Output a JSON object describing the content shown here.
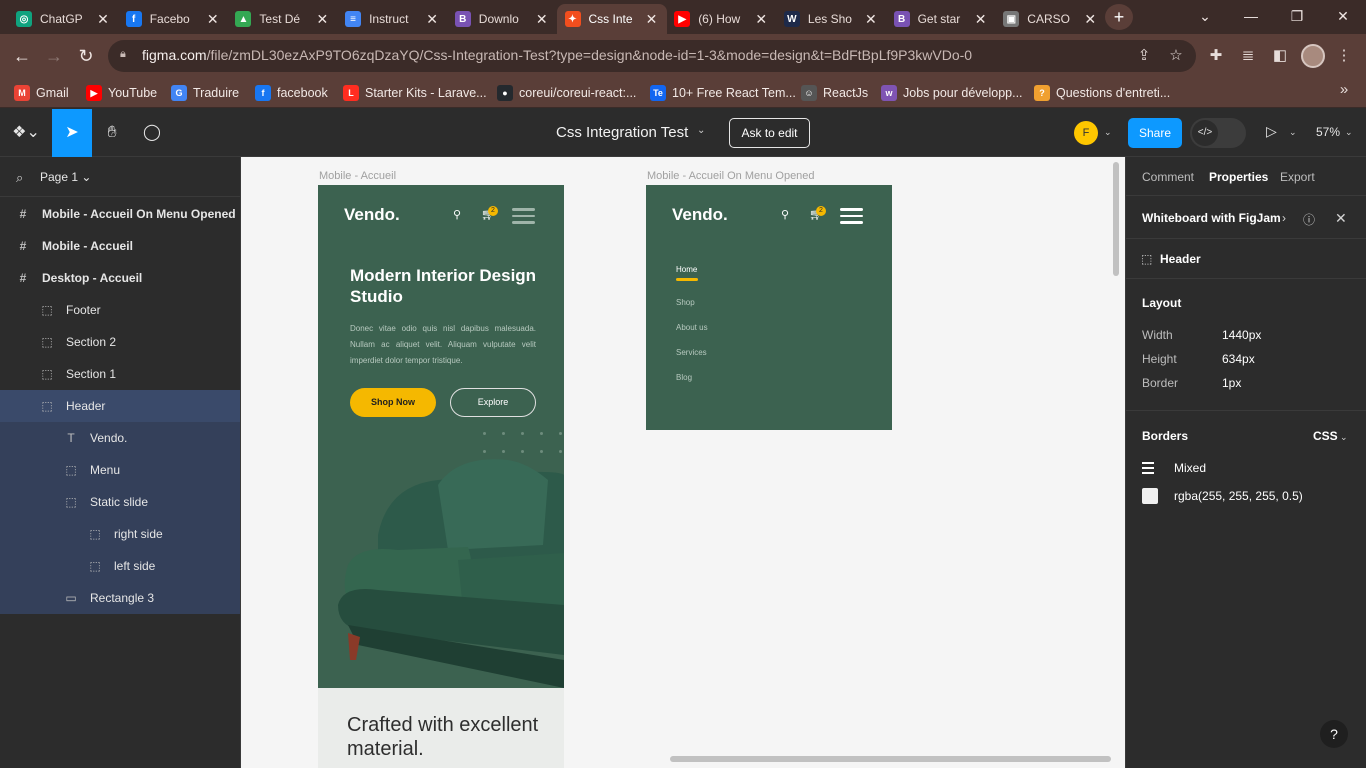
{
  "browser": {
    "tabs": [
      {
        "title": "ChatGP",
        "icon": "chatgpt-icon",
        "color": "#10a37f",
        "glyph": "◎"
      },
      {
        "title": "Facebo",
        "icon": "facebook-icon",
        "color": "#1877f2",
        "glyph": "f"
      },
      {
        "title": "Test Dé",
        "icon": "google-drive-icon",
        "color": "#34a853",
        "glyph": "▲"
      },
      {
        "title": "Instruct",
        "icon": "google-docs-icon",
        "color": "#4285f4",
        "glyph": "≡"
      },
      {
        "title": "Downlo",
        "icon": "bootstrap-icon",
        "color": "#7952b3",
        "glyph": "B"
      },
      {
        "title": "Css Inte",
        "icon": "figma-icon",
        "color": "#f24e1e",
        "glyph": "✦"
      },
      {
        "title": "(6) How",
        "icon": "youtube-icon",
        "color": "#ff0000",
        "glyph": "▶"
      },
      {
        "title": "Les Sho",
        "icon": "w-icon",
        "color": "#1e2a4a",
        "glyph": "W"
      },
      {
        "title": "Get star",
        "icon": "bootstrap-icon",
        "color": "#7952b3",
        "glyph": "B"
      },
      {
        "title": "CARSO",
        "icon": "carso-icon",
        "color": "#777777",
        "glyph": "▣"
      }
    ],
    "active_tab_index": 5,
    "url_host": "figma.com",
    "url_path": "/file/zmDL30ezAxP9TO6zqDzaYQ/Css-Integration-Test?type=design&node-id=1-3&mode=design&t=BdFtBpLf9P3kwVDo-0",
    "bookmarks": [
      {
        "label": "Gmail",
        "icon": "gmail-icon",
        "color": "#ea4335",
        "glyph": "M"
      },
      {
        "label": "YouTube",
        "icon": "youtube-icon",
        "color": "#ff0000",
        "glyph": "▶"
      },
      {
        "label": "Traduire",
        "icon": "google-translate-icon",
        "color": "#4285f4",
        "glyph": "G"
      },
      {
        "label": "facebook",
        "icon": "facebook-icon",
        "color": "#1877f2",
        "glyph": "f"
      },
      {
        "label": "Starter Kits - Larave...",
        "icon": "laravel-icon",
        "color": "#ff2d20",
        "glyph": "L"
      },
      {
        "label": "coreui/coreui-react:...",
        "icon": "github-icon",
        "color": "#24292e",
        "glyph": "●"
      },
      {
        "label": "10+ Free React Tem...",
        "icon": "te-icon",
        "color": "#1266f1",
        "glyph": "Te"
      },
      {
        "label": "ReactJs",
        "icon": "reactjs-icon",
        "color": "#555555",
        "glyph": "☺"
      },
      {
        "label": "Jobs pour développ...",
        "icon": "woo-icon",
        "color": "#7f54b3",
        "glyph": "w"
      },
      {
        "label": "Questions d'entreti...",
        "icon": "questions-icon",
        "color": "#f0a030",
        "glyph": "?"
      }
    ]
  },
  "figma": {
    "file_title": "Css Integration Test",
    "ask_to_edit": "Ask to edit",
    "avatar_initial": "F",
    "share": "Share",
    "zoom": "57%",
    "page_label": "Page 1",
    "layers": [
      {
        "label": "Mobile - Accueil On Menu Opened",
        "icon": "#",
        "indent": 0,
        "bold": true,
        "state": ""
      },
      {
        "label": "Mobile - Accueil",
        "icon": "#",
        "indent": 0,
        "bold": true,
        "state": ""
      },
      {
        "label": "Desktop - Accueil",
        "icon": "#",
        "indent": 0,
        "bold": true,
        "state": ""
      },
      {
        "label": "Footer",
        "icon": "⬚",
        "indent": 1,
        "bold": false,
        "state": ""
      },
      {
        "label": "Section 2",
        "icon": "⬚",
        "indent": 1,
        "bold": false,
        "state": ""
      },
      {
        "label": "Section 1",
        "icon": "⬚",
        "indent": 1,
        "bold": false,
        "state": ""
      },
      {
        "label": "Header",
        "icon": "⬚",
        "indent": 1,
        "bold": false,
        "state": "sel"
      },
      {
        "label": "Vendo.",
        "icon": "T",
        "indent": 2,
        "bold": false,
        "state": "child"
      },
      {
        "label": "Menu",
        "icon": "⬚",
        "indent": 2,
        "bold": false,
        "state": "child"
      },
      {
        "label": "Static slide",
        "icon": "⬚",
        "indent": 2,
        "bold": false,
        "state": "child"
      },
      {
        "label": "right side",
        "icon": "⬚",
        "indent": 3,
        "bold": false,
        "state": "child"
      },
      {
        "label": "left side",
        "icon": "⬚",
        "indent": 3,
        "bold": false,
        "state": "child"
      },
      {
        "label": "Rectangle 3",
        "icon": "▭",
        "indent": 2,
        "bold": false,
        "state": "child"
      }
    ],
    "canvas": {
      "frame1_label": "Mobile - Accueil",
      "frame2_label": "Mobile - Accueil On Menu Opened",
      "logo": "Vendo.",
      "cart_count": "2",
      "hero_title": "Modern Interior Design Studio",
      "hero_text": "Donec vitae odio quis nisl dapibus malesuada. Nullam ac aliquet velit. Aliquam vulputate velit imperdiet dolor tempor tristique.",
      "shop_now": "Shop Now",
      "explore": "Explore",
      "crafted": "Crafted with excellent material.",
      "menu": [
        "Home",
        "Shop",
        "About us",
        "Services",
        "Blog"
      ]
    },
    "right_panel": {
      "tabs": [
        "Comment",
        "Properties",
        "Export"
      ],
      "active_tab": "Properties",
      "whiteboard": "Whiteboard with FigJam",
      "selection_name": "Header",
      "layout_title": "Layout",
      "width_label": "Width",
      "width_value": "1440px",
      "height_label": "Height",
      "height_value": "634px",
      "border_label": "Border",
      "border_value": "1px",
      "borders_title": "Borders",
      "css_label": "CSS",
      "mixed": "Mixed",
      "border_color": "rgba(255, 255, 255, 0.5)"
    }
  }
}
